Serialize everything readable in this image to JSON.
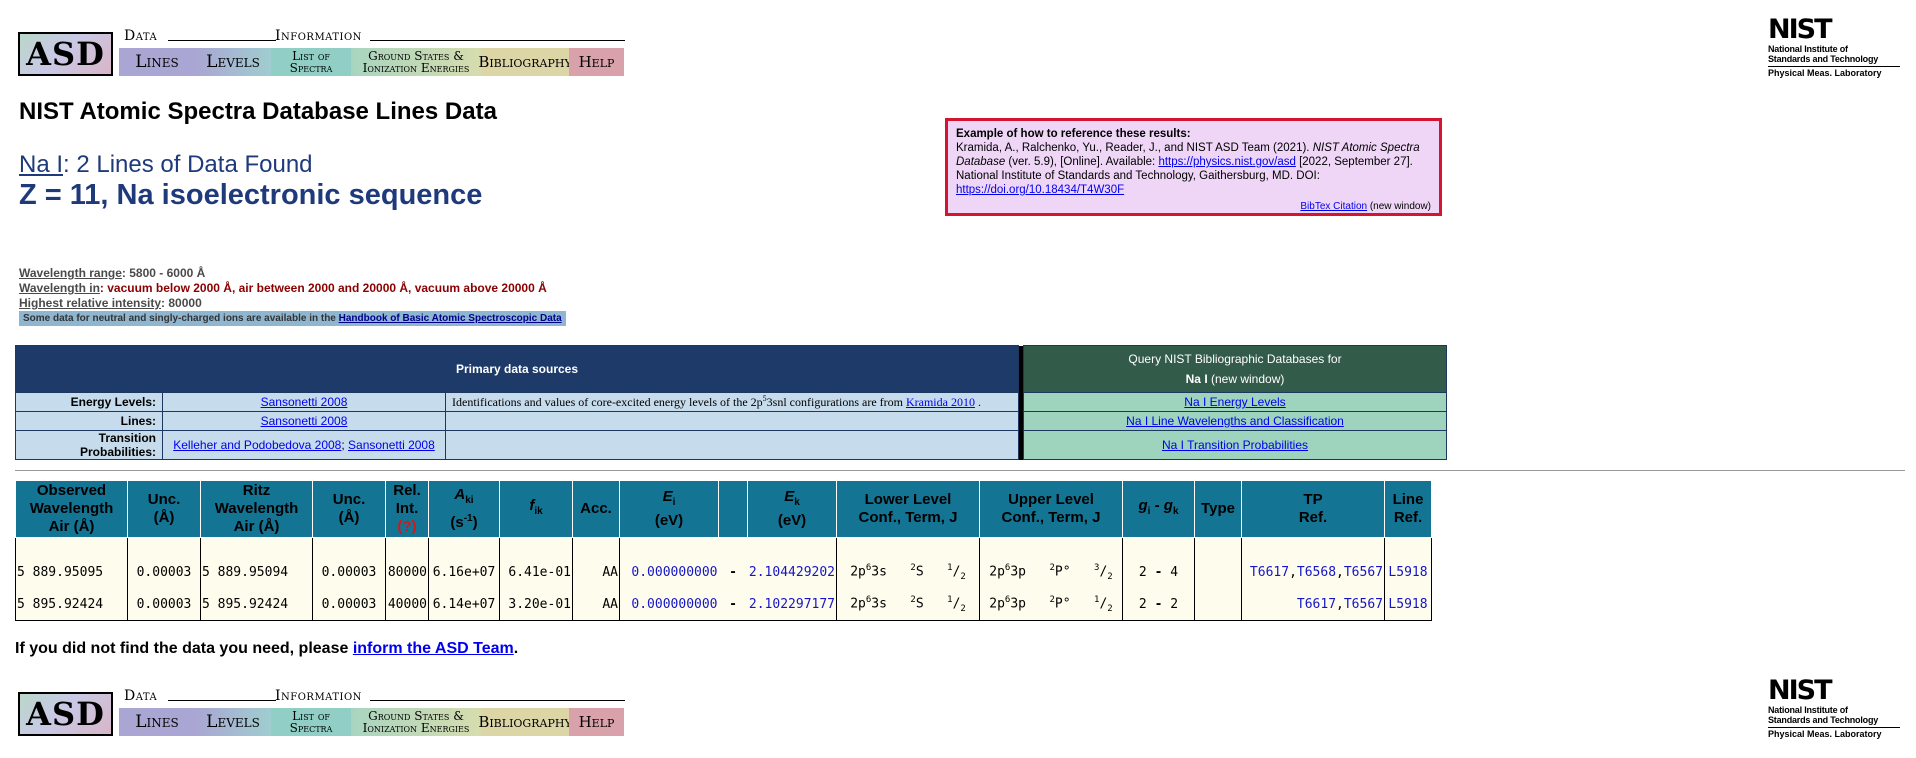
{
  "nav": {
    "logo": "ASD",
    "data_caption": "Data",
    "info_caption": "Information",
    "lines": "Lines",
    "levels": "Levels",
    "list_line1": "List of",
    "list_line2": "Spectra",
    "ground_line1": "Ground States &",
    "ground_line2": "Ionization Energies",
    "bibliography": "Bibliography",
    "help": "Help"
  },
  "nist": {
    "word": "NIST",
    "sub1": "National Institute of",
    "sub2": "Standards and Technology",
    "lab": "Physical Meas. Laboratory"
  },
  "page_title": "NIST Atomic Spectra Database Lines Data",
  "spectrum": "Na I",
  "found_text": ": 2 Lines of Data Found",
  "sequence": "Z = 11, Na isoelectronic sequence",
  "citation": {
    "heading": "Example of how to reference these results:",
    "text1": "Kramida, A., Ralchenko, Yu., Reader, J., and NIST ASD Team (2021). ",
    "title": "NIST Atomic Spectra Database",
    "text2": " (ver. 5.9), [Online]. Available: ",
    "url": "https://physics.nist.gov/asd",
    "text3": " [2022, September 27]. National Institute of Standards and Technology, Gaithersburg, MD. DOI: ",
    "doi": "https://doi.org/10.18434/T4W30F",
    "bibtex": "BibTex Citation",
    "bibtex_note": " (new window)"
  },
  "params": {
    "range_label": "Wavelength range",
    "range_value": ": 5800 - 6000 Å",
    "in_label": "Wavelength in",
    "in_value": ": vacuum below 2000 Å, air between 2000 and 20000 Å, vacuum above 20000 Å",
    "intensity_label": "Highest relative intensity",
    "intensity_value": ": 80000",
    "handbook_text": "Some data for neutral and singly-charged ions are available in the ",
    "handbook_link": "Handbook of Basic Atomic Spectroscopic Data"
  },
  "sources": {
    "header": "Primary data sources",
    "query_line1": "Query NIST Bibliographic Databases for",
    "query_line2_bold": "Na I",
    "query_line2": " (new window)",
    "energy_label": "Energy Levels:",
    "energy_ref": "Sansonetti 2008",
    "energy_note_a": "Identifications and values of core-excited energy levels of the 2p",
    "energy_note_sup": "5",
    "energy_note_b": "3snl configurations are from ",
    "energy_note_link": "Kramida 2010",
    "energy_note_end": " .",
    "lines_label": "Lines:",
    "lines_ref": "Sansonetti 2008",
    "tp_label": "Transition Probabilities:",
    "tp_ref1": "Kelleher and Podobedova 2008",
    "tp_sep": "; ",
    "tp_ref2": "Sansonetti 2008",
    "q_energy": "Na I Energy Levels",
    "q_lines": "Na I Line Wavelengths and Classification",
    "q_tp": "Na I Transition Probabilities"
  },
  "table": {
    "h_obs": [
      "Observed",
      "Wavelength",
      "Air (Å)"
    ],
    "h_unc1": [
      "Unc.",
      "(Å)"
    ],
    "h_ritz": [
      "Ritz",
      "Wavelength",
      "Air (Å)"
    ],
    "h_unc2": [
      "Unc.",
      "(Å)"
    ],
    "h_rel": [
      "Rel.",
      "Int."
    ],
    "h_rel_q": "(?)",
    "h_aki": "A",
    "h_aki_sub": "ki",
    "h_aki_unit": "(s",
    "h_aki_exp": "-1",
    "h_aki_close": ")",
    "h_fik": "f",
    "h_fik_sub": "ik",
    "h_acc": "Acc.",
    "h_ei": "E",
    "h_ei_sub": "i",
    "h_ei_unit": "(eV)",
    "h_ek": "E",
    "h_ek_sub": "k",
    "h_ek_unit": "(eV)",
    "h_lower": [
      "Lower Level",
      "Conf., Term, J"
    ],
    "h_upper": [
      "Upper Level",
      "Conf., Term, J"
    ],
    "h_g": "g",
    "h_g_sub_i": "i",
    "h_g_dash": " - ",
    "h_g_sub_k": "k",
    "h_type": "Type",
    "h_tp": [
      "TP",
      "Ref."
    ],
    "h_line": [
      "Line",
      "Ref."
    ],
    "rows": [
      {
        "obs": "5 889.95095",
        "unc1": "0.00003",
        "ritz": "5 889.95094",
        "unc2": "0.00003",
        "rel": "80000",
        "aki": "6.16e+07",
        "fik": "6.41e-01",
        "acc": "AA",
        "ei": "0.000000000",
        "dash": "-",
        "ek": "2.104429202",
        "lconf_a": "2p",
        "lconf_sup": "6",
        "lconf_b": "3s",
        "lterm_sup": "2",
        "lterm": "S",
        "lj_num": "1",
        "lj_den": "2",
        "uconf_a": "2p",
        "uconf_sup": "6",
        "uconf_b": "3p",
        "uterm_sup": "2",
        "uterm": "P°",
        "uj_num": "3",
        "uj_den": "2",
        "gi": "2",
        "gdash": "-",
        "gk": "4",
        "tp": [
          "T6617",
          "T6568",
          "T6567"
        ],
        "lref": "L5918"
      },
      {
        "obs": "5 895.92424",
        "unc1": "0.00003",
        "ritz": "5 895.92424",
        "unc2": "0.00003",
        "rel": "40000",
        "aki": "6.14e+07",
        "fik": "3.20e-01",
        "acc": "AA",
        "ei": "0.000000000",
        "dash": "-",
        "ek": "2.102297177",
        "lconf_a": "2p",
        "lconf_sup": "6",
        "lconf_b": "3s",
        "lterm_sup": "2",
        "lterm": "S",
        "lj_num": "1",
        "lj_den": "2",
        "uconf_a": "2p",
        "uconf_sup": "6",
        "uconf_b": "3p",
        "uterm_sup": "2",
        "uterm": "P°",
        "uj_num": "1",
        "uj_den": "2",
        "gi": "2",
        "gdash": "-",
        "gk": "2",
        "tp": [
          "T6617",
          "T6567"
        ],
        "lref": "L5918"
      }
    ]
  },
  "not_found_text": "If you did not find the data you need, please ",
  "not_found_link": "inform the ASD Team",
  "not_found_end": ".",
  "colors": {
    "lines_btn": "#aaa6d3",
    "list_btn": "#91cfc6",
    "ground_btn": "#c4dcb3",
    "biblio_btn": "#dcd7a8",
    "help_btn": "#dca0a8"
  }
}
